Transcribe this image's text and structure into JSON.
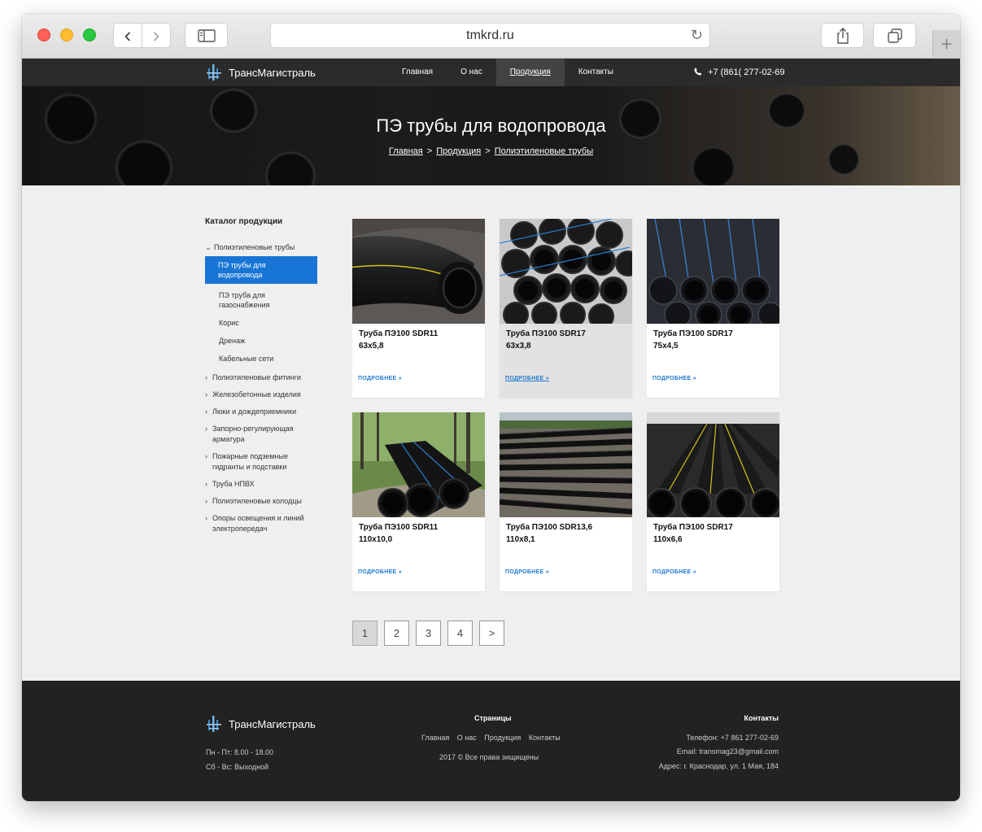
{
  "browser": {
    "url": "tmkrd.ru",
    "back_glyph": "‹",
    "forward_glyph": "›",
    "reload_glyph": "↻",
    "newtab_glyph": "+"
  },
  "nav": {
    "logo_text": "ТрансМагистраль",
    "links": [
      "Главная",
      "О нас",
      "Продукция",
      "Контакты"
    ],
    "active_link": "Продукция",
    "phone": "+7 (861( 277-02-69"
  },
  "hero": {
    "title": "ПЭ трубы для водопровода",
    "breadcrumbs": [
      "Главная",
      "Продукция",
      "Полиэтиленовые трубы"
    ],
    "separator": ">"
  },
  "sidebar": {
    "title": "Каталог продукции",
    "expanded_group": "Полиэтиленовые трубы",
    "subitems": [
      "ПЭ трубы для водопровода",
      "ПЭ труба для газоснабжения",
      "Корис",
      "Дренаж",
      "Кабельные сети"
    ],
    "active_subitem": "ПЭ трубы для водопровода",
    "groups": [
      "Полиэтиленовые фитинги",
      "Железобетонные изделия",
      "Люки и дождеприемники",
      "Запорно-регулирующая арматура",
      "Пожарные подземные гидранты и подставки",
      "Труба НПВХ",
      "Полиэтиленовые колодцы",
      "Опоры освещения и линий электропередач"
    ]
  },
  "products": [
    {
      "name": "Труба ПЭ100 SDR11",
      "size": "63х5,8",
      "more": "ПОДРОБНЕЕ »"
    },
    {
      "name": "Труба ПЭ100 SDR17",
      "size": "63х3,8",
      "more": "ПОДРОБНЕЕ »"
    },
    {
      "name": "Труба ПЭ100 SDR17",
      "size": "75х4,5",
      "more": "ПОДРОБНЕЕ »"
    },
    {
      "name": "Труба ПЭ100 SDR11",
      "size": "110х10,0",
      "more": "ПОДРОБНЕЕ »"
    },
    {
      "name": "Труба ПЭ100 SDR13,6",
      "size": "110х8,1",
      "more": "ПОДРОБНЕЕ »"
    },
    {
      "name": "Труба ПЭ100 SDR17",
      "size": "110х6,6",
      "more": "ПОДРОБНЕЕ »"
    }
  ],
  "pagination": {
    "pages": [
      "1",
      "2",
      "3",
      "4"
    ],
    "next": ">",
    "current": "1"
  },
  "footer": {
    "logo_text": "ТрансМагистраль",
    "hours_weekdays": "Пн - Пт: 8.00 - 18.00",
    "hours_weekend": "Сб - Вс: Выходной",
    "pages_title": "Страницы",
    "pages": [
      "Главная",
      "О нас",
      "Продукция",
      "Контакты"
    ],
    "copyright": "2017 ©   Все права зищищены",
    "contacts_title": "Контакты",
    "phone": "Телефон:  +7 861 277-02-69",
    "email": "Email: transmag23@gmail.com",
    "address": "Адрес: г. Краснодар,  ул. 1 Мая, 184"
  },
  "colors": {
    "accent": "#1875d6",
    "nav_bg": "#2b2b2b",
    "footer_bg": "#222222",
    "link": "#1f7ad0"
  }
}
